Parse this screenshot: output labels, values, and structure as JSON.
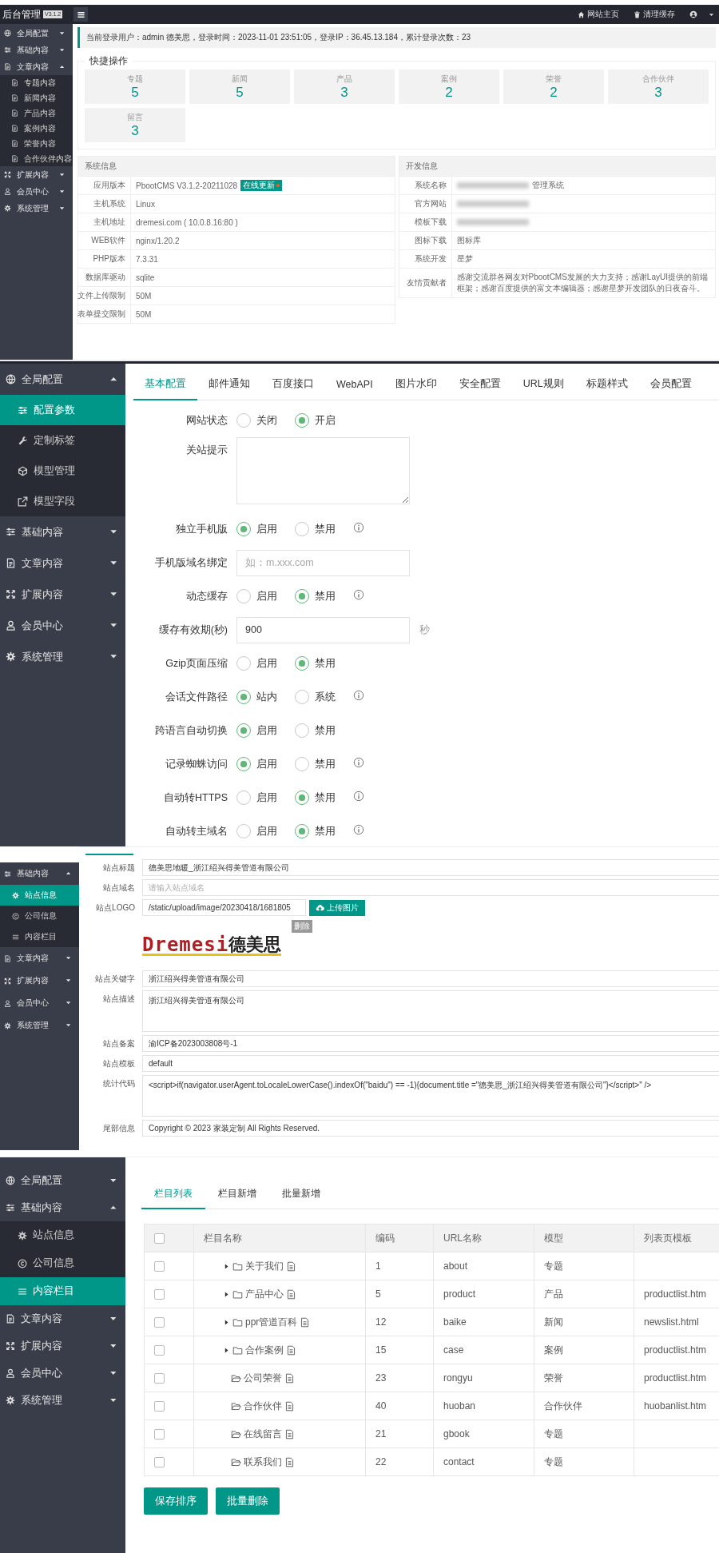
{
  "panels": [
    {
      "kind": "dashboard",
      "header": {
        "title": "后台管理",
        "version": "V3.1.2",
        "links": [
          {
            "label": "网站主页",
            "kind": "home"
          },
          {
            "label": "清理缓存",
            "kind": "trash"
          }
        ]
      },
      "sidebar": [
        {
          "label": "全局配置",
          "kind": "globe",
          "expanded": false,
          "selected": false
        },
        {
          "label": "基础内容",
          "kind": "sliders",
          "expanded": false,
          "selected": false
        },
        {
          "label": "文章内容",
          "kind": "doc",
          "expanded": true,
          "selected": false,
          "children": [
            {
              "label": "专题内容",
              "kind": "doc",
              "selected": false
            },
            {
              "label": "新闻内容",
              "kind": "doc",
              "selected": false
            },
            {
              "label": "产品内容",
              "kind": "doc",
              "selected": false
            },
            {
              "label": "案例内容",
              "kind": "doc",
              "selected": false
            },
            {
              "label": "荣誉内容",
              "kind": "doc",
              "selected": false
            },
            {
              "label": "合作伙伴内容",
              "kind": "doc",
              "selected": false
            }
          ]
        },
        {
          "label": "扩展内容",
          "kind": "arrows",
          "expanded": false,
          "selected": false
        },
        {
          "label": "会员中心",
          "kind": "user",
          "expanded": false,
          "selected": false
        },
        {
          "label": "系统管理",
          "kind": "gear",
          "expanded": false,
          "selected": false
        }
      ],
      "login_info": "当前登录用户：admin 德美思，登录时间：2023-11-01 23:51:05，登录IP：36.45.13.184，累计登录次数：23",
      "quick": {
        "title": "快捷操作",
        "cards": [
          {
            "label": "专题",
            "count": "5"
          },
          {
            "label": "新闻",
            "count": "5"
          },
          {
            "label": "产品",
            "count": "3"
          },
          {
            "label": "案例",
            "count": "2"
          },
          {
            "label": "荣誉",
            "count": "2"
          },
          {
            "label": "合作伙伴",
            "count": "3"
          },
          {
            "label": "留言",
            "count": "3"
          }
        ]
      },
      "system_info": {
        "title": "系统信息",
        "rows": [
          {
            "label": "应用版本",
            "value": "PbootCMS V3.1.2-20211028",
            "badge": "在线更新"
          },
          {
            "label": "主机系统",
            "value": "Linux"
          },
          {
            "label": "主机地址",
            "value": "dremesi.com ( 10.0.8.16:80 )"
          },
          {
            "label": "WEB软件",
            "value": "nginx/1.20.2"
          },
          {
            "label": "PHP版本",
            "value": "7.3.31"
          },
          {
            "label": "数据库驱动",
            "value": "sqlite"
          },
          {
            "label": "文件上传限制",
            "value": "50M"
          },
          {
            "label": "表单提交限制",
            "value": "50M"
          }
        ]
      },
      "dev_info": {
        "title": "开发信息",
        "rows": [
          {
            "label": "系统名称",
            "value": "管理系统",
            "redacted": true
          },
          {
            "label": "官方网站",
            "redacted": true
          },
          {
            "label": "模板下载",
            "redacted": true
          },
          {
            "label": "图标下载",
            "value": "图标库",
            "redacted": false
          },
          {
            "label": "系统开发",
            "value": "星梦",
            "redacted": false
          },
          {
            "label": "友情贡献者",
            "value": "感谢交流群各网友对PbootCMS发展的大力支持；感谢LayUI提供的前端框架；感谢百度提供的富文本编辑器；感谢星梦开发团队的日夜奋斗。",
            "redacted": false
          }
        ]
      }
    },
    {
      "kind": "config",
      "sidebar": [
        {
          "label": "全局配置",
          "kind": "globe",
          "expanded": true,
          "selected": false,
          "children": [
            {
              "label": "配置参数",
              "kind": "sliders",
              "selected": true
            },
            {
              "label": "定制标签",
              "kind": "wrench",
              "selected": false
            },
            {
              "label": "模型管理",
              "kind": "cube",
              "selected": false
            },
            {
              "label": "模型字段",
              "kind": "link",
              "selected": false
            }
          ]
        },
        {
          "label": "基础内容",
          "kind": "sliders",
          "expanded": false,
          "selected": false
        },
        {
          "label": "文章内容",
          "kind": "doc",
          "expanded": false,
          "selected": false
        },
        {
          "label": "扩展内容",
          "kind": "arrows",
          "expanded": false,
          "selected": false
        },
        {
          "label": "会员中心",
          "kind": "user",
          "expanded": false,
          "selected": false
        },
        {
          "label": "系统管理",
          "kind": "gear",
          "expanded": false,
          "selected": false
        }
      ],
      "tabs": [
        {
          "label": "基本配置",
          "selected": true
        },
        {
          "label": "邮件通知",
          "selected": false
        },
        {
          "label": "百度接口",
          "selected": false
        },
        {
          "label": "WebAPI",
          "selected": false
        },
        {
          "label": "图片水印",
          "selected": false
        },
        {
          "label": "安全配置",
          "selected": false
        },
        {
          "label": "URL规则",
          "selected": false
        },
        {
          "label": "标题样式",
          "selected": false
        },
        {
          "label": "会员配置",
          "selected": false
        }
      ],
      "fields": [
        {
          "kind": "radio",
          "label": "网站状态",
          "info": false,
          "options": [
            {
              "label": "关闭",
              "selected": false
            },
            {
              "label": "开启",
              "selected": true
            }
          ]
        },
        {
          "kind": "textarea",
          "label": "关站提示"
        },
        {
          "kind": "radio",
          "label": "独立手机版",
          "info": true,
          "options": [
            {
              "label": "启用",
              "selected": true
            },
            {
              "label": "禁用",
              "selected": false
            }
          ]
        },
        {
          "kind": "text",
          "label": "手机版域名绑定",
          "placeholder": "如：m.xxx.com"
        },
        {
          "kind": "radio",
          "label": "动态缓存",
          "info": true,
          "options": [
            {
              "label": "启用",
              "selected": false
            },
            {
              "label": "禁用",
              "selected": true
            }
          ]
        },
        {
          "kind": "text",
          "label": "缓存有效期(秒)",
          "value": "900",
          "suffix": "秒"
        },
        {
          "kind": "radio",
          "label": "Gzip页面压缩",
          "info": false,
          "options": [
            {
              "label": "启用",
              "selected": false
            },
            {
              "label": "禁用",
              "selected": true
            }
          ]
        },
        {
          "kind": "radio",
          "label": "会话文件路径",
          "info": true,
          "options": [
            {
              "label": "站内",
              "selected": true
            },
            {
              "label": "系统",
              "selected": false
            }
          ]
        },
        {
          "kind": "radio",
          "label": "跨语言自动切换",
          "info": false,
          "options": [
            {
              "label": "启用",
              "selected": true
            },
            {
              "label": "禁用",
              "selected": false
            }
          ]
        },
        {
          "kind": "radio",
          "label": "记录蜘蛛访问",
          "info": true,
          "options": [
            {
              "label": "启用",
              "selected": true
            },
            {
              "label": "禁用",
              "selected": false
            }
          ]
        },
        {
          "kind": "radio",
          "label": "自动转HTTPS",
          "info": true,
          "options": [
            {
              "label": "启用",
              "selected": false
            },
            {
              "label": "禁用",
              "selected": true
            }
          ]
        },
        {
          "kind": "radio",
          "label": "自动转主域名",
          "info": true,
          "options": [
            {
              "label": "启用",
              "selected": false
            },
            {
              "label": "禁用",
              "selected": true
            }
          ]
        }
      ]
    },
    {
      "kind": "site",
      "sidebar": [
        {
          "label": "基础内容",
          "kind": "sliders",
          "expanded": true,
          "selected": false,
          "children": [
            {
              "label": "站点信息",
              "kind": "gear",
              "selected": true
            },
            {
              "label": "公司信息",
              "kind": "copyright",
              "selected": false
            },
            {
              "label": "内容栏目",
              "kind": "list",
              "selected": false
            }
          ]
        },
        {
          "label": "文章内容",
          "kind": "doc",
          "expanded": false,
          "selected": false
        },
        {
          "label": "扩展内容",
          "kind": "arrows",
          "expanded": false,
          "selected": false
        },
        {
          "label": "会员中心",
          "kind": "user",
          "expanded": false,
          "selected": false
        },
        {
          "label": "系统管理",
          "kind": "gear",
          "expanded": false,
          "selected": false
        }
      ],
      "fields": [
        {
          "kind": "text",
          "label": "站点标题",
          "value": "德美思地暖_浙江绍兴得美管道有限公司"
        },
        {
          "kind": "text",
          "label": "站点域名",
          "placeholder": "请输入站点域名"
        },
        {
          "kind": "upload",
          "label": "站点LOGO",
          "value": "/static/upload/image/20230418/1681805",
          "button": "上传图片",
          "delete": "删除",
          "logo": {
            "latin": "Dremesi",
            "cjk": "德美思"
          }
        },
        {
          "kind": "text",
          "label": "站点关键字",
          "value": "浙江绍兴得美管道有限公司"
        },
        {
          "kind": "textarea",
          "label": "站点描述",
          "value": "浙江绍兴得美管道有限公司"
        },
        {
          "kind": "text",
          "label": "站点备案",
          "value": "渝ICP备2023003808号-1"
        },
        {
          "kind": "text",
          "label": "站点模板",
          "value": "default"
        },
        {
          "kind": "textarea",
          "label": "统计代码",
          "value": "<script>if(navigator.userAgent.toLocaleLowerCase().indexOf(\"baidu\") == -1){document.title =\"德美思_浙江绍兴得美管道有限公司\"}</script>\" />"
        },
        {
          "kind": "text",
          "label": "尾部信息",
          "value": "Copyright © 2023 家装定制 All Rights Reserved."
        }
      ]
    },
    {
      "kind": "columns",
      "sidebar": [
        {
          "label": "全局配置",
          "kind": "globe",
          "expanded": false,
          "selected": false
        },
        {
          "label": "基础内容",
          "kind": "sliders",
          "expanded": true,
          "selected": false,
          "children": [
            {
              "label": "站点信息",
              "kind": "gear",
              "selected": false
            },
            {
              "label": "公司信息",
              "kind": "copyright",
              "selected": false
            },
            {
              "label": "内容栏目",
              "kind": "list",
              "selected": true
            }
          ]
        },
        {
          "label": "文章内容",
          "kind": "doc",
          "expanded": false,
          "selected": false
        },
        {
          "label": "扩展内容",
          "kind": "arrows",
          "expanded": false,
          "selected": false
        },
        {
          "label": "会员中心",
          "kind": "user",
          "expanded": false,
          "selected": false
        },
        {
          "label": "系统管理",
          "kind": "gear",
          "expanded": false,
          "selected": false
        }
      ],
      "tabs": [
        {
          "label": "栏目列表",
          "selected": true
        },
        {
          "label": "栏目新增",
          "selected": false
        },
        {
          "label": "批量新增",
          "selected": false
        }
      ],
      "table": {
        "select_all": {
          "checked": false
        },
        "columns": [
          "栏目名称",
          "编码",
          "URL名称",
          "模型",
          "列表页模板"
        ],
        "rows": [
          {
            "checked": false,
            "has_children": true,
            "name": "关于我们",
            "code": "1",
            "url": "about",
            "model": "专题"
          },
          {
            "checked": false,
            "has_children": true,
            "name": "产品中心",
            "code": "5",
            "url": "product",
            "model": "产品",
            "template": "productlist.htm"
          },
          {
            "checked": false,
            "has_children": true,
            "name": "ppr管道百科",
            "code": "12",
            "url": "baike",
            "model": "新闻",
            "template": "newslist.html"
          },
          {
            "checked": false,
            "has_children": true,
            "name": "合作案例",
            "code": "15",
            "url": "case",
            "model": "案例",
            "template": "productlist.htm"
          },
          {
            "checked": false,
            "has_children": false,
            "name": "公司荣誉",
            "code": "23",
            "url": "rongyu",
            "model": "荣誉",
            "template": "productlist.htm"
          },
          {
            "checked": false,
            "has_children": false,
            "name": "合作伙伴",
            "code": "40",
            "url": "huoban",
            "model": "合作伙伴",
            "template": "huobanlist.htm"
          },
          {
            "checked": false,
            "has_children": false,
            "name": "在线留言",
            "code": "21",
            "url": "gbook",
            "model": "专题"
          },
          {
            "checked": false,
            "has_children": false,
            "name": "联系我们",
            "code": "22",
            "url": "contact",
            "model": "专题"
          }
        ]
      },
      "buttons": [
        "保存排序",
        "批量删除"
      ]
    }
  ]
}
